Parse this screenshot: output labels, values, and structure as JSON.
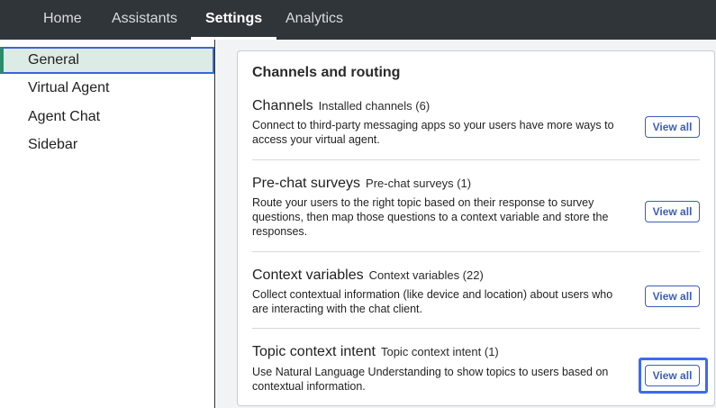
{
  "topnav": {
    "tabs": [
      {
        "label": "Home",
        "active": false
      },
      {
        "label": "Assistants",
        "active": false
      },
      {
        "label": "Settings",
        "active": true
      },
      {
        "label": "Analytics",
        "active": false
      }
    ]
  },
  "sidebar": {
    "items": [
      {
        "label": "General",
        "active": true
      },
      {
        "label": "Virtual Agent",
        "active": false
      },
      {
        "label": "Agent Chat",
        "active": false
      },
      {
        "label": "Sidebar",
        "active": false
      }
    ]
  },
  "main": {
    "section_title": "Channels and routing",
    "rows": [
      {
        "title": "Channels",
        "count": "Installed channels (6)",
        "description": "Connect to third-party messaging apps so your users have more ways to access your virtual agent.",
        "button": "View all"
      },
      {
        "title": "Pre-chat surveys",
        "count": "Pre-chat surveys (1)",
        "description": "Route your users to the right topic based on their response to survey questions, then map those questions to a context variable and store the responses.",
        "button": "View all"
      },
      {
        "title": "Context variables",
        "count": "Context variables (22)",
        "description": "Collect contextual information (like device and location) about users who are interacting with the chat client.",
        "button": "View all"
      },
      {
        "title": "Topic context intent",
        "count": "Topic context intent (1)",
        "description": "Use Natural Language Understanding to show topics to users based on contextual information.",
        "button": "View all",
        "focused": true
      }
    ]
  },
  "colors": {
    "topbar": "#30353a",
    "accent": "#3b5fb5",
    "active_sidebar_bg": "#dcebe6",
    "focus": "#3b6bf0"
  }
}
